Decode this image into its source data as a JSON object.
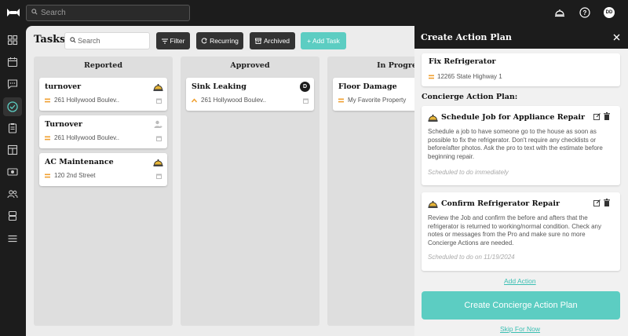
{
  "topbar": {
    "search_placeholder": "Search",
    "avatar_initials": "DD"
  },
  "sidebar": {
    "icons": [
      "grid-icon",
      "calendar-icon",
      "chat-icon",
      "tasks-icon",
      "clipboard-icon",
      "board-icon",
      "money-icon",
      "people-icon",
      "stack-icon",
      "menu-icon"
    ]
  },
  "toolbar": {
    "title": "Tasks",
    "search_placeholder": "Search",
    "filter_label": "Filter",
    "recurring_label": "Recurring",
    "archived_label": "Archived",
    "add_task_label": "+ Add Task"
  },
  "columns": [
    {
      "title": "Reported",
      "cards": [
        {
          "title": "turnover",
          "address": "261 Hollywood Boulev..",
          "priority": "medium",
          "badge": "concierge-bell"
        },
        {
          "title": "Turnover",
          "address": "261 Hollywood Boulev..",
          "priority": "medium",
          "badge": "person"
        },
        {
          "title": "AC Maintenance",
          "address": "120 2nd Street",
          "priority": "medium",
          "badge": "concierge-bell"
        }
      ]
    },
    {
      "title": "Approved",
      "cards": [
        {
          "title": "Sink Leaking",
          "address": "261 Hollywood Boulev..",
          "priority": "high",
          "badge": "D"
        }
      ]
    },
    {
      "title": "In Progre",
      "cards": [
        {
          "title": "Floor Damage",
          "address": "My Favorite Property",
          "priority": "medium",
          "badge": ""
        }
      ]
    }
  ],
  "panel": {
    "title": "Create Action Plan",
    "task": {
      "title": "Fix Refrigerator",
      "address": "12265 State Highway 1"
    },
    "section_label": "Concierge Action Plan:",
    "actions": [
      {
        "title": "Schedule Job for Appliance Repair",
        "description": "Schedule a job to have someone go to the house as soon as possible to fix the refrigerator. Don't require any checklists or before/after photos. Ask the pro to text with the estimate before beginning repair.",
        "schedule": "Scheduled to do immediately"
      },
      {
        "title": "Confirm Refrigerator Repair",
        "description": "Review the Job and confirm the before and afters that the refrigerator is returned to working/normal condition. Check any notes or messages from the Pro and make sure no more Concierge Actions are needed.",
        "schedule": "Scheduled to do on 11/19/2024"
      }
    ],
    "add_action_label": "Add Action",
    "create_button_label": "Create Concierge Action Plan",
    "skip_label": "Skip For Now"
  },
  "colors": {
    "teal": "#5ccdc2",
    "dark": "#1c1c1c",
    "priority_orange": "#f0a030"
  }
}
